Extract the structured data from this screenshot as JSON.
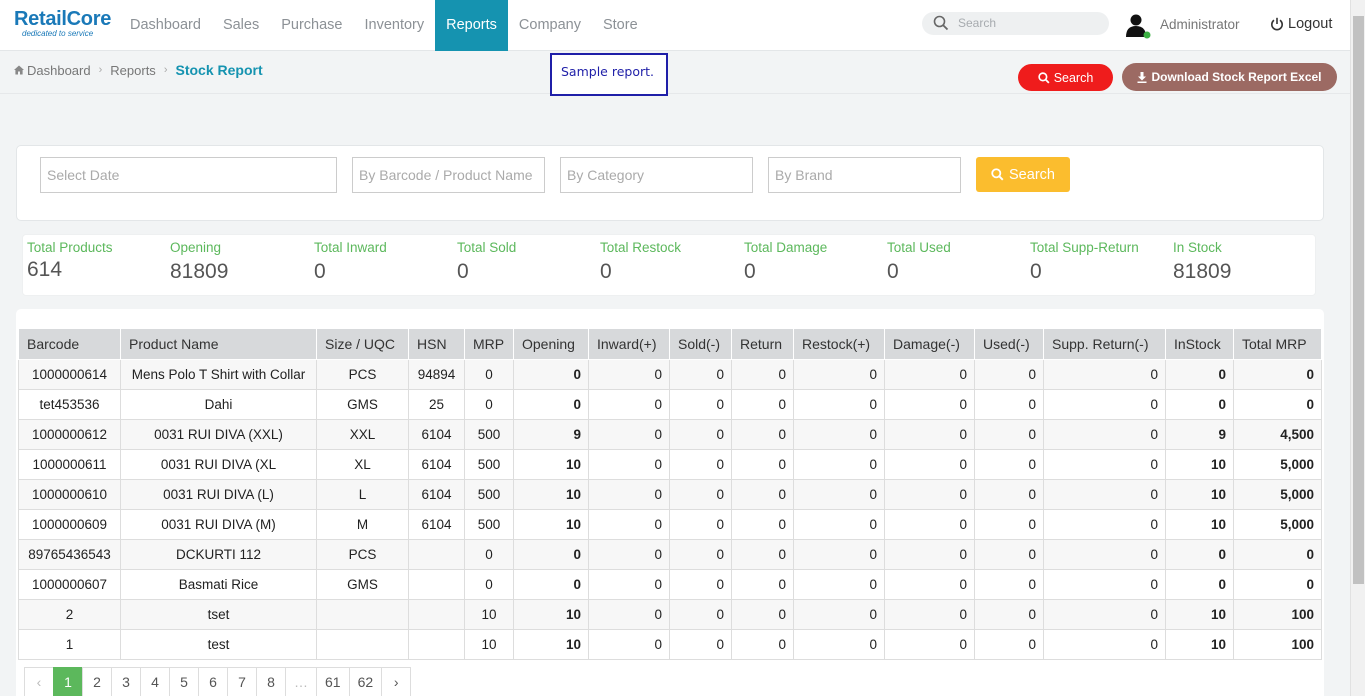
{
  "brand": {
    "name": "RetailCore",
    "tagline": "dedicated to service"
  },
  "nav": [
    "Dashboard",
    "Sales",
    "Purchase",
    "Inventory",
    "Reports",
    "Company",
    "Store"
  ],
  "search": {
    "placeholder": "Search"
  },
  "user": {
    "name": "Administrator",
    "logout": "Logout"
  },
  "breadcrumb": {
    "home": "Dashboard",
    "section": "Reports",
    "current": "Stock Report"
  },
  "annotation": "Sample report.",
  "actions": {
    "search": "Search",
    "download": "Download Stock Report Excel"
  },
  "filters": {
    "date": "Select Date",
    "product": "By Barcode / Product Name",
    "category": "By Category",
    "brand": "By Brand",
    "button": "Search"
  },
  "stats": [
    {
      "label": "Total Products",
      "value": "614"
    },
    {
      "label": "Opening",
      "value": "81809"
    },
    {
      "label": "Total Inward",
      "value": "0"
    },
    {
      "label": "Total Sold",
      "value": "0"
    },
    {
      "label": "Total Restock",
      "value": "0"
    },
    {
      "label": "Total Damage",
      "value": "0"
    },
    {
      "label": "Total Used",
      "value": "0"
    },
    {
      "label": "Total Supp-Return",
      "value": "0"
    },
    {
      "label": "In Stock",
      "value": "81809"
    }
  ],
  "table": {
    "columns": [
      "Barcode",
      "Product Name",
      "Size / UQC",
      "HSN",
      "MRP",
      "Opening",
      "Inward(+)",
      "Sold(-)",
      "Return",
      "Restock(+)",
      "Damage(-)",
      "Used(-)",
      "Supp. Return(-)",
      "InStock",
      "Total MRP"
    ],
    "rows": [
      [
        "1000000614",
        "Mens Polo T Shirt with Collar",
        "PCS",
        "94894",
        "0",
        "0",
        "0",
        "0",
        "0",
        "0",
        "0",
        "0",
        "0",
        "0",
        "0"
      ],
      [
        "tet453536",
        "Dahi",
        "GMS",
        "25",
        "0",
        "0",
        "0",
        "0",
        "0",
        "0",
        "0",
        "0",
        "0",
        "0",
        "0"
      ],
      [
        "1000000612",
        "0031 RUI DIVA (XXL)",
        "XXL",
        "6104",
        "500",
        "9",
        "0",
        "0",
        "0",
        "0",
        "0",
        "0",
        "0",
        "9",
        "4,500"
      ],
      [
        "1000000611",
        "0031 RUI DIVA (XL",
        "XL",
        "6104",
        "500",
        "10",
        "0",
        "0",
        "0",
        "0",
        "0",
        "0",
        "0",
        "10",
        "5,000"
      ],
      [
        "1000000610",
        "0031 RUI DIVA (L)",
        "L",
        "6104",
        "500",
        "10",
        "0",
        "0",
        "0",
        "0",
        "0",
        "0",
        "0",
        "10",
        "5,000"
      ],
      [
        "1000000609",
        "0031 RUI DIVA (M)",
        "M",
        "6104",
        "500",
        "10",
        "0",
        "0",
        "0",
        "0",
        "0",
        "0",
        "0",
        "10",
        "5,000"
      ],
      [
        "89765436543",
        "DCKURTI 112",
        "PCS",
        "",
        "0",
        "0",
        "0",
        "0",
        "0",
        "0",
        "0",
        "0",
        "0",
        "0",
        "0"
      ],
      [
        "1000000607",
        "Basmati Rice",
        "GMS",
        "",
        "0",
        "0",
        "0",
        "0",
        "0",
        "0",
        "0",
        "0",
        "0",
        "0",
        "0"
      ],
      [
        "2",
        "tset",
        "",
        "",
        "10",
        "10",
        "0",
        "0",
        "0",
        "0",
        "0",
        "0",
        "0",
        "10",
        "100"
      ],
      [
        "1",
        "test",
        "",
        "",
        "10",
        "10",
        "0",
        "0",
        "0",
        "0",
        "0",
        "0",
        "0",
        "10",
        "100"
      ]
    ]
  },
  "pagination": [
    "‹",
    "1",
    "2",
    "3",
    "4",
    "5",
    "6",
    "7",
    "8",
    "…",
    "61",
    "62",
    "›"
  ],
  "colors": {
    "accent": "#1593b0",
    "danger": "#ef1c1c",
    "download": "#9c6a63",
    "warning": "#fbbd2e",
    "success": "#5cb85c"
  }
}
